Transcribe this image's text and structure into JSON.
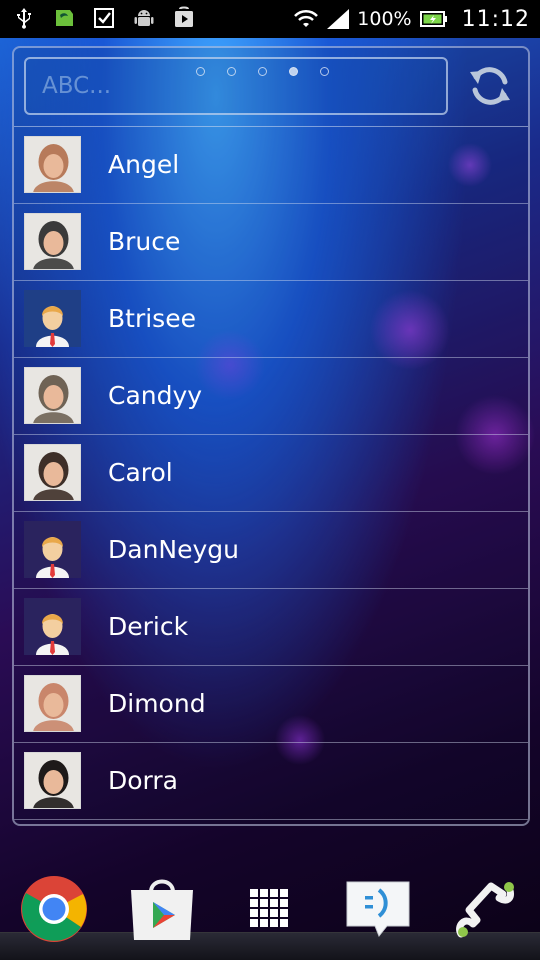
{
  "status_bar": {
    "icons_left": [
      "usb-icon",
      "sd-card-icon",
      "checkbox-icon",
      "android-debug-icon",
      "play-store-icon"
    ],
    "battery_percent": "100%",
    "time": "11:12",
    "icons_right": [
      "wifi-icon",
      "signal-icon",
      "battery-icon"
    ]
  },
  "widget": {
    "search": {
      "placeholder": "ABC...",
      "value": ""
    },
    "page_dots": {
      "count": 5,
      "active_index": 3
    },
    "refresh_icon": "refresh-icon",
    "contacts": [
      {
        "name": "Angel",
        "avatar": "photo",
        "tone": "#b77a5a"
      },
      {
        "name": "Bruce",
        "avatar": "photo",
        "tone": "#3a3a3a"
      },
      {
        "name": "Btrisee",
        "avatar": "default",
        "tone": "#1f3f86"
      },
      {
        "name": "Candyy",
        "avatar": "photo",
        "tone": "#6f6355"
      },
      {
        "name": "Carol",
        "avatar": "photo",
        "tone": "#3e2f28"
      },
      {
        "name": "DanNeygu",
        "avatar": "default",
        "tone": "#2a235e"
      },
      {
        "name": "Derick",
        "avatar": "default",
        "tone": "#2a235e"
      },
      {
        "name": "Dimond",
        "avatar": "photo",
        "tone": "#c9866b"
      },
      {
        "name": "Dorra",
        "avatar": "photo",
        "tone": "#1e1a19"
      }
    ]
  },
  "dock": {
    "items": [
      "chrome-icon",
      "play-store-icon",
      "app-drawer-icon",
      "messaging-icon",
      "phone-icon"
    ]
  },
  "colors": {
    "status_bar_bg": "#000000",
    "accent_blue": "#1a58d6",
    "wallpaper_purple": "#2a0c55"
  }
}
